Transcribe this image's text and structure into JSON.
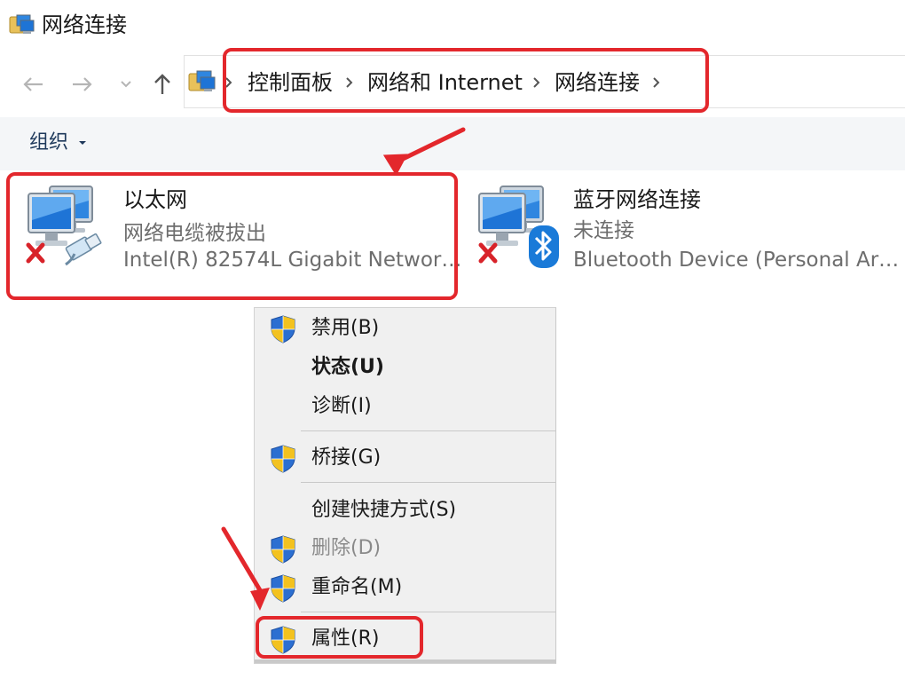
{
  "window": {
    "title": "网络连接"
  },
  "breadcrumb": {
    "items": [
      "控制面板",
      "网络和 Internet",
      "网络连接"
    ]
  },
  "toolbar": {
    "organize_label": "组织"
  },
  "connections": [
    {
      "name": "以太网",
      "status": "网络电缆被拔出",
      "device": "Intel(R) 82574L Gigabit Networ…",
      "icon": "ethernet-disconnected-icon"
    },
    {
      "name": "蓝牙网络连接",
      "status": "未连接",
      "device": "Bluetooth Device (Personal Ar…",
      "icon": "bluetooth-disconnected-icon"
    }
  ],
  "context_menu": {
    "items": [
      {
        "label": "禁用(B)",
        "shield": true,
        "bold": false,
        "disabled": false
      },
      {
        "label": "状态(U)",
        "shield": false,
        "bold": true,
        "disabled": false
      },
      {
        "label": "诊断(I)",
        "shield": false,
        "bold": false,
        "disabled": false
      },
      {
        "label": "桥接(G)",
        "shield": true,
        "bold": false,
        "disabled": false
      },
      {
        "label": "创建快捷方式(S)",
        "shield": false,
        "bold": false,
        "disabled": false
      },
      {
        "label": "删除(D)",
        "shield": true,
        "bold": false,
        "disabled": true
      },
      {
        "label": "重命名(M)",
        "shield": true,
        "bold": false,
        "disabled": false
      },
      {
        "label": "属性(R)",
        "shield": true,
        "bold": false,
        "disabled": false
      }
    ]
  },
  "colors": {
    "highlight": "#e3272c",
    "toolbar_bg": "#f4f6f8",
    "menu_bg": "#f0f0f0",
    "secondary_text": "#6d6d6d"
  }
}
